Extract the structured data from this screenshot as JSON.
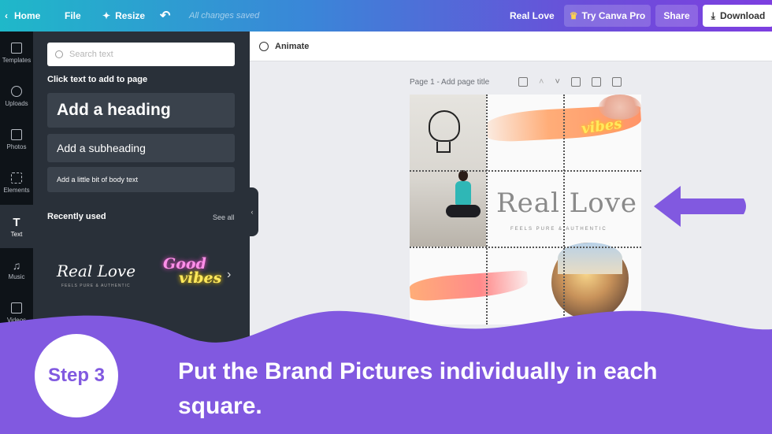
{
  "topbar": {
    "home": "Home",
    "file": "File",
    "resize": "Resize",
    "saved": "All changes saved",
    "doc_title": "Real Love",
    "try_pro": "Try Canva Pro",
    "share": "Share",
    "download": "Download"
  },
  "rail": {
    "items": [
      {
        "label": "Templates",
        "icon": "templates-icon"
      },
      {
        "label": "Uploads",
        "icon": "upload-icon"
      },
      {
        "label": "Photos",
        "icon": "photos-icon"
      },
      {
        "label": "Elements",
        "icon": "elements-icon"
      },
      {
        "label": "Text",
        "icon": "text-icon"
      },
      {
        "label": "Music",
        "icon": "music-icon"
      },
      {
        "label": "Videos",
        "icon": "videos-icon"
      }
    ]
  },
  "panel": {
    "search_placeholder": "Search text",
    "click_hint": "Click text to add to page",
    "heading": "Add a heading",
    "subheading": "Add a subheading",
    "body": "Add a little bit of body text",
    "recently_used": "Recently used",
    "see_all": "See all",
    "recent_sample1": "Real Love",
    "recent_sample1_sub": "FEELS PURE & AUTHENTIC",
    "recent_sample2_a": "Good",
    "recent_sample2_b": "vibes"
  },
  "workspace": {
    "animate": "Animate",
    "page_title": "Page 1 - Add page title"
  },
  "design": {
    "vibes": "vibes",
    "title": "Real Love",
    "tagline": "FEELS PURE & AUTHENTIC"
  },
  "banner": {
    "step": "Step 3",
    "text": "Put the Brand Pictures individually in each square."
  },
  "colors": {
    "accent_purple": "#8159e0",
    "download_bg": "#ffffff"
  }
}
